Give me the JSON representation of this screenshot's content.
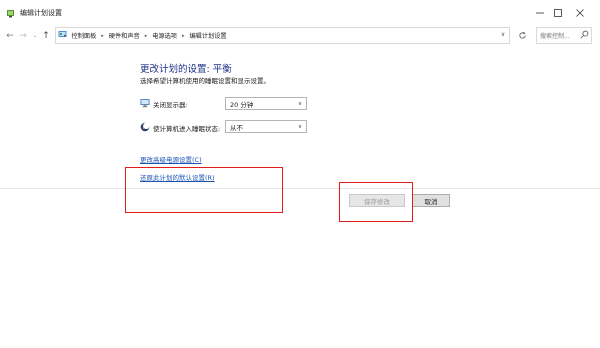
{
  "window": {
    "title": "编辑计划设置"
  },
  "address_bar": {
    "breadcrumbs": [
      "控制面板",
      "硬件和声音",
      "电源选项",
      "编辑计划设置"
    ]
  },
  "search": {
    "placeholder": "搜索控制..."
  },
  "page": {
    "title": "更改计划的设置: 平衡",
    "description": "选择希望计算机使用的睡眠设置和显示设置。"
  },
  "settings": {
    "display_off": {
      "label": "关闭显示器:",
      "value": "20 分钟"
    },
    "sleep": {
      "label": "使计算机进入睡眠状态:",
      "value": "从不"
    }
  },
  "links": {
    "advanced": "更改高级电源设置(C)",
    "restore": "还原此计划的默认设置(R)"
  },
  "buttons": {
    "save": "保存修改",
    "cancel": "取消"
  },
  "colors": {
    "accent_title": "#1e3287",
    "link": "#1b53b4",
    "highlight": "#e21b1b"
  }
}
